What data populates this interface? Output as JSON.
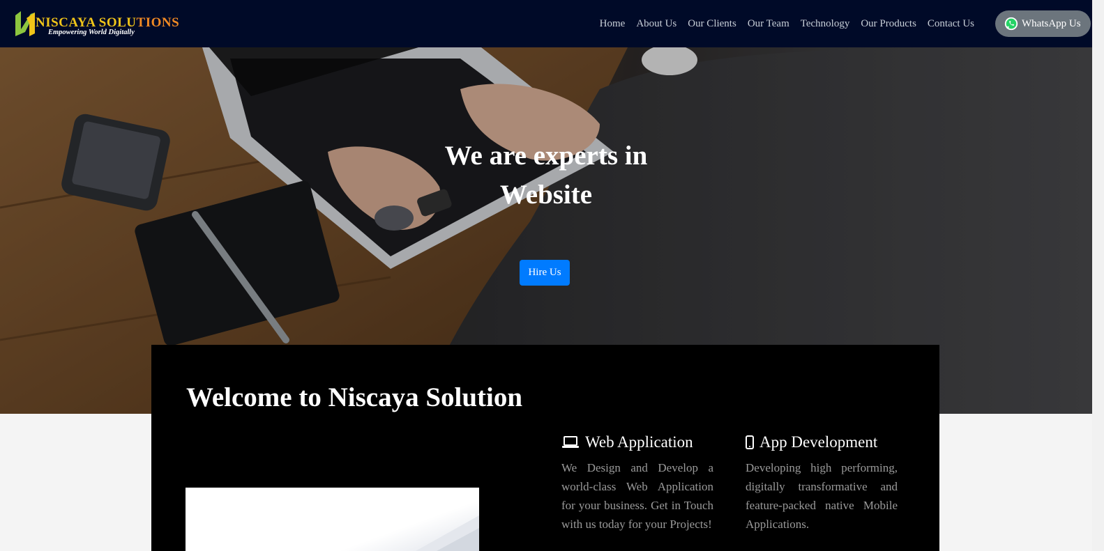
{
  "brand": {
    "name": "NISCAYA SOLUTIONS",
    "name_main": "NISCAYA SOLU",
    "name_tail": "TIONS",
    "tagline": "Empowering World Digitally"
  },
  "nav": {
    "items": [
      {
        "label": "Home"
      },
      {
        "label": "About Us"
      },
      {
        "label": "Our Clients"
      },
      {
        "label": "Our Team"
      },
      {
        "label": "Technology"
      },
      {
        "label": "Our Products"
      },
      {
        "label": "Contact Us"
      }
    ],
    "whatsapp_label": "WhatsApp Us"
  },
  "hero": {
    "title_line1": "We are experts in",
    "title_line2": "Website",
    "cta_label": "Hire Us"
  },
  "welcome": {
    "heading": "Welcome to Niscaya Solution"
  },
  "services": [
    {
      "icon": "laptop-icon",
      "title": "Web Application",
      "text": "We Design and Develop a world-class Web Application for your business. Get in Touch with us today for your Projects!"
    },
    {
      "icon": "mobile-phone-icon",
      "title": "App Development",
      "text": "Developing high performing, digitally transformative and feature-packed native Mobile Applications."
    }
  ],
  "colors": {
    "navbar": "#000a28",
    "accent": "#007bff",
    "whatsapp_pill": "#6c757d",
    "logo_gold": "#f0c419",
    "logo_orange": "#f08a24",
    "logo_green": "#8dc63f"
  }
}
